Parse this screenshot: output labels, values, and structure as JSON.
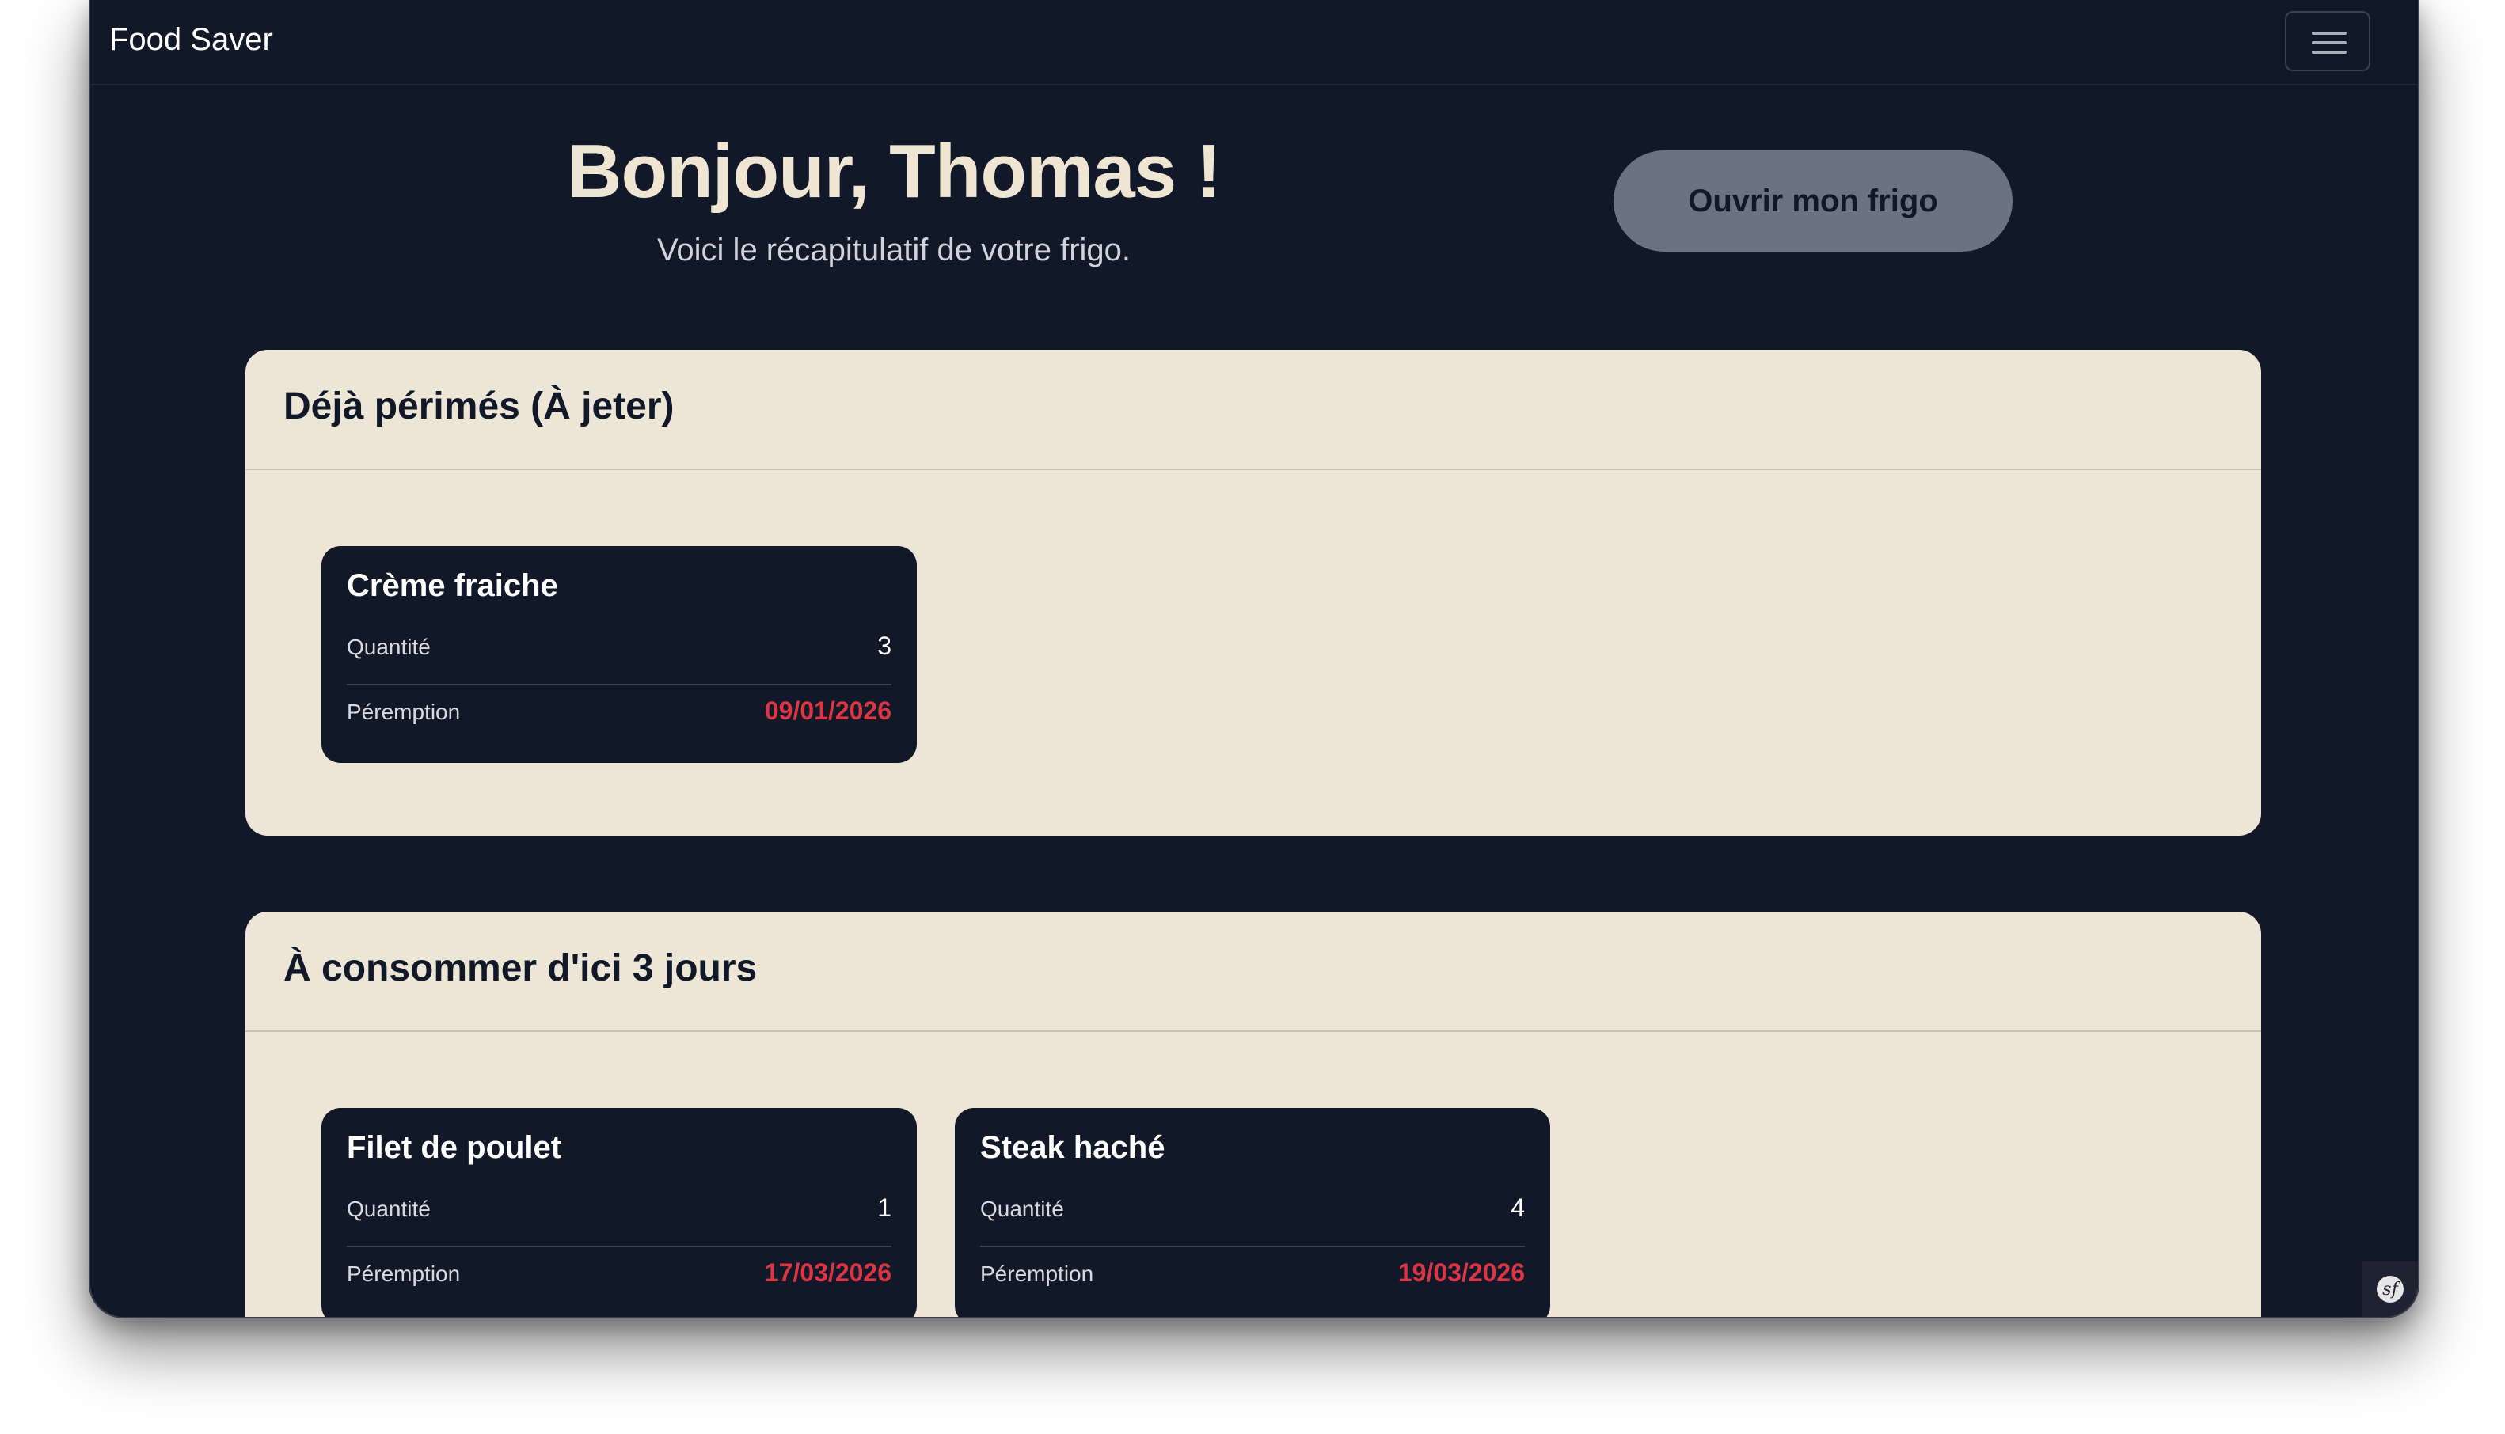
{
  "navbar": {
    "brand": "Food Saver",
    "menu_icon": "hamburger-menu-icon"
  },
  "hero": {
    "title": "Bonjour, Thomas !",
    "subtitle": "Voici le récapitulatif de votre frigo.",
    "open_button": "Ouvrir mon frigo"
  },
  "sections": [
    {
      "title": "Déjà périmés (À jeter)",
      "items": [
        {
          "name": "Crème fraiche",
          "quantity_label": "Quantité",
          "quantity": "3",
          "expiry_label": "Péremption",
          "expiry": "09/01/2026"
        }
      ]
    },
    {
      "title": "À consommer d'ici 3 jours",
      "items": [
        {
          "name": "Filet de poulet",
          "quantity_label": "Quantité",
          "quantity": "1",
          "expiry_label": "Péremption",
          "expiry": "17/03/2026"
        },
        {
          "name": "Steak haché",
          "quantity_label": "Quantité",
          "quantity": "4",
          "expiry_label": "Péremption",
          "expiry": "19/03/2026"
        }
      ]
    }
  ],
  "toolbar": {
    "icon": "symfony-icon",
    "glyph": "sf"
  },
  "colors": {
    "background": "#111827",
    "card_surface": "#ede5d5",
    "accent_danger": "#dc3545",
    "button": "#6b7280"
  }
}
